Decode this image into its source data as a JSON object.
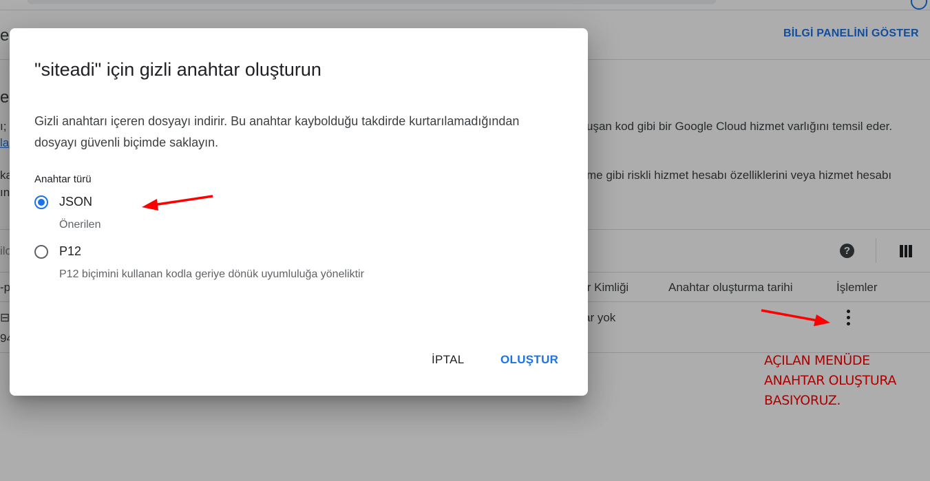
{
  "background": {
    "info_panel_button": "BİLGİ PANELİNİ GÖSTER",
    "fragments": {
      "header_left": "e",
      "section_left": "e",
      "desc_left_1": "ı;",
      "desc_left_2": "la",
      "desc_left_3": "ka",
      "desc_left_4": "ın",
      "desc_right_1": "uşan kod gibi bir Google Cloud hizmet varlığını temsil eder.",
      "desc_right_2": "me gibi riskli hizmet hesabı özelliklerini veya hizmet hesabı",
      "filter_left": "ilo",
      "col_left": "-p",
      "row_left_id": "94"
    },
    "table": {
      "col_key_id": "ır Kimliği",
      "col_created": "Anahtar oluşturma tarihi",
      "col_actions": "İşlemler",
      "row_value": "ar yok"
    },
    "icons": {
      "help": "help-icon",
      "columns": "column-display-icon",
      "actions": "more-vert-icon"
    }
  },
  "annotation": {
    "note_lines": [
      "AÇILAN MENÜDE",
      "ANAHTAR OLUŞTURA",
      "BASIYORUZ."
    ],
    "color": "#ff0000"
  },
  "dialog": {
    "title": "\"siteadi\" için gizli anahtar oluşturun",
    "description_lines": [
      "Gizli anahtarı içeren dosyayı indirir. Bu anahtar kaybolduğu takdirde kurtarılamadığından",
      "dosyayı güvenli biçimde saklayın."
    ],
    "key_type_label": "Anahtar türü",
    "options": [
      {
        "label": "JSON",
        "sub": "Önerilen",
        "selected": true
      },
      {
        "label": "P12",
        "sub": "P12 biçimini kullanan kodla geriye dönük uyumluluğa yöneliktir",
        "selected": false
      }
    ],
    "cancel_label": "İPTAL",
    "create_label": "OLUŞTUR"
  },
  "colors": {
    "accent": "#1a73e8",
    "scrim": "rgba(0,0,0,0.32)"
  }
}
